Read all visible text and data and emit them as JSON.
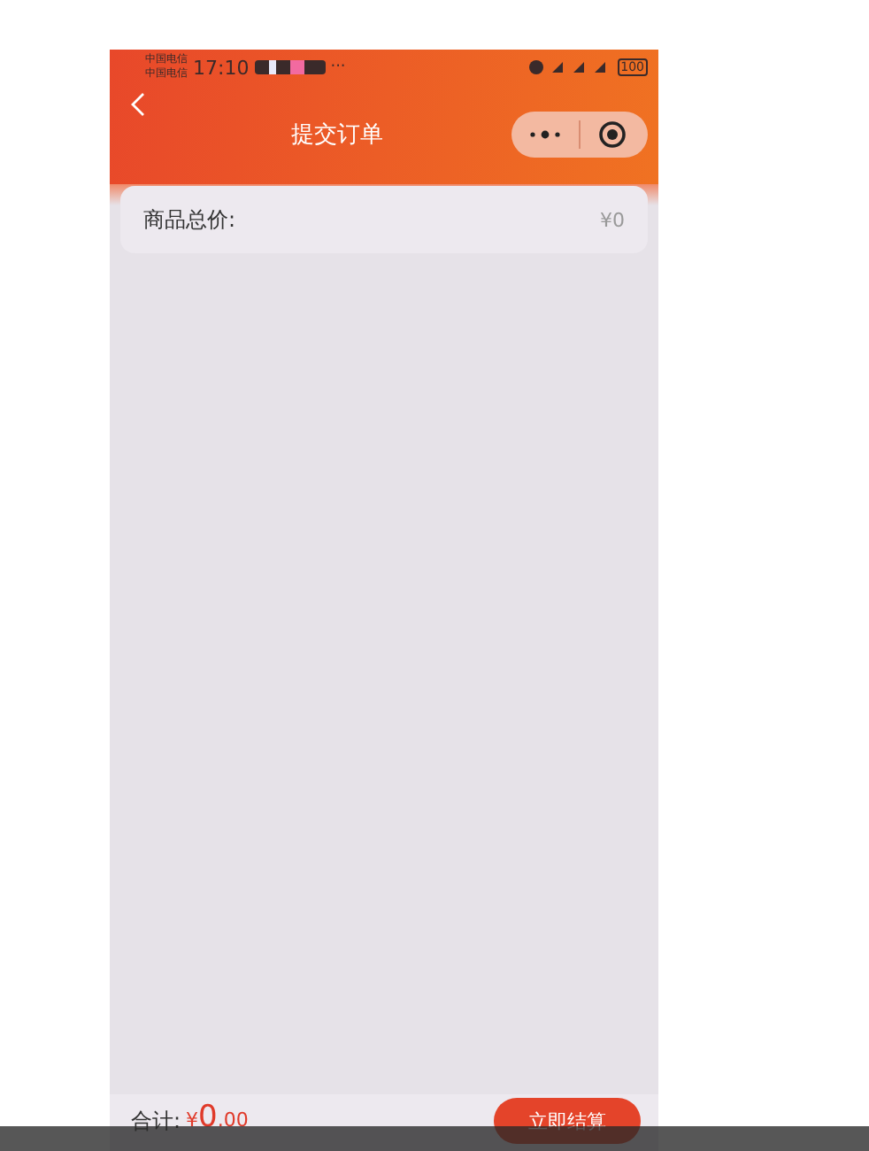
{
  "status_bar": {
    "carriers": [
      "中国电信",
      "中国电信"
    ],
    "time": "17:10",
    "more": "···",
    "battery": "100"
  },
  "header": {
    "title": "提交订单"
  },
  "summary": {
    "label": "商品总价:",
    "value": "¥0"
  },
  "footer": {
    "total_label": "合计:",
    "currency": "¥",
    "integer": "0",
    "decimal": ".00",
    "button": "立即结算"
  }
}
